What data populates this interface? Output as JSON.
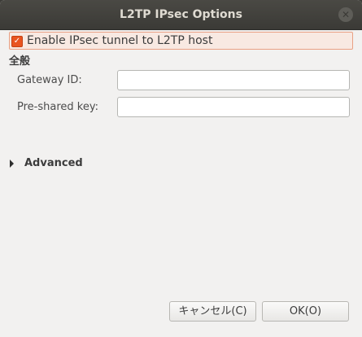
{
  "window": {
    "title": "L2TP IPsec Options",
    "close_glyph": "✕"
  },
  "enable_ipsec": {
    "checked": true,
    "check_glyph": "✓",
    "label": "Enable IPsec tunnel to L2TP host"
  },
  "general": {
    "section_label": "全般",
    "gateway_id": {
      "label": "Gateway ID:",
      "value": "",
      "placeholder": ""
    },
    "pre_shared_key": {
      "label": "Pre-shared key:",
      "value": "",
      "placeholder": ""
    }
  },
  "advanced": {
    "label": "Advanced",
    "expanded": false
  },
  "buttons": {
    "cancel": "キャンセル(C)",
    "ok": "OK(O)"
  },
  "colors": {
    "accent": "#e95420",
    "titlebar": "#3b3a36",
    "background": "#f2f1f0"
  },
  "icons": {
    "close": "close-icon",
    "expander": "triangle-right-icon"
  }
}
